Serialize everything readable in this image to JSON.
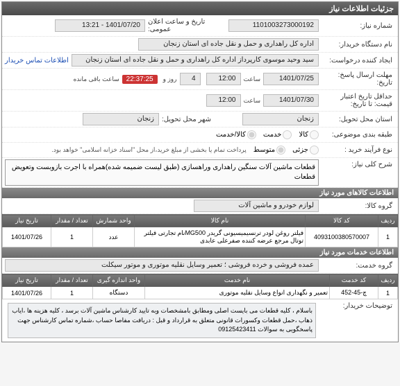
{
  "panel_title": "جزئیات اطلاعات نیاز",
  "rows": {
    "need_no_label": "شماره نیاز:",
    "need_no": "1101003273000192",
    "ann_label": "تاریخ و ساعت اعلان عمومی:",
    "ann_value": "1401/07/20 - 13:21",
    "org_label": "نام دستگاه خریدار:",
    "org_value": "اداره کل راهداری و حمل و نقل جاده ای استان زنجان",
    "creator_label": "ایجاد کننده درخواست:",
    "creator_value": "سید وحید موسوی کارپرداز اداره کل راهداری و حمل و نقل جاده ای استان زنجان",
    "contact_link": "اطلاعات تماس خریدار",
    "deadline_label": "مهلت ارسال پاسخ:",
    "deadline_until_label": "تاریخ:",
    "deadline_date": "1401/07/25",
    "time_label": "ساعت",
    "deadline_time": "12:00",
    "day_label": "روز و",
    "day_value": "4",
    "remain_label": "ساعت باقی مانده",
    "remain_value": "22:37:25",
    "valid_label": "حداقل تاریخ اعتبار",
    "valid_until_label": "قیمت: تا تاریخ:",
    "valid_date": "1401/07/30",
    "valid_time": "12:00",
    "prov_label": "استان محل تحویل:",
    "prov_value": "زنجان",
    "city_label": "شهر محل تحویل:",
    "city_value": "زنجان",
    "cat_label": "طبقه بندی موضوعی:",
    "cat_goods": "کالا",
    "cat_service": "خدمت",
    "cat_both": "کالا/خدمت",
    "proc_label": "نوع فرآیند خرید :",
    "proc_part": "جزئی",
    "proc_med": "متوسط",
    "proc_note": "پرداخت تمام یا بخشی از مبلغ خرید،از محل \"اسناد خزانه اسلامی\" خواهد بود.",
    "title_label": "شرح کلی نیاز:",
    "title_value": "قطعات ماشین آلات سنگین راهداری وراهسازی (طبق لیست ضمیمه شده)همراه با اجرت بازوبست وتعویض قطعات"
  },
  "goods": {
    "header": "اطلاعات کالاهای مورد نیاز",
    "group_label": "گروه کالا:",
    "group_value": "لوازم خودرو و ماشین آلات",
    "cols": {
      "row": "ردیف",
      "code": "کد کالا",
      "name": "نام کالا",
      "unit": "واحد شمارش",
      "qty": "تعداد / مقدار",
      "date": "تاریخ نیاز"
    },
    "items": [
      {
        "row": "1",
        "code": "4093100380570007",
        "name": "فیلتر روغن لودر ترنسیمیسیونی گریدر MG500نام تجارتی فیلتر توتال مرجع عرضه کننده صفرعلی عابدی",
        "unit": "عدد",
        "qty": "1",
        "date": "1401/07/26"
      }
    ]
  },
  "services": {
    "header": "اطلاعات خدمات مورد نیاز",
    "group_label": "گروه خدمت:",
    "group_value": "عمده فروشی و خرده فروشی ؛ تعمیر وسایل نقلیه موتوری و موتور سیکلت",
    "cols": {
      "row": "ردیف",
      "code": "کد خدمت",
      "name": "نام خدمت",
      "unit": "واحد اندازه گیری",
      "qty": "تعداد / مقدار",
      "date": "تاریخ نیاز"
    },
    "items": [
      {
        "row": "1",
        "code": "چ-45-452",
        "name": "تعمیر و نگهداری انواع وسایل نقلیه موتوری",
        "unit": "دستگاه",
        "qty": "1",
        "date": "1401/07/26"
      }
    ]
  },
  "notes": {
    "label": "توضیحات خریدار:",
    "text": "باسلام ، کلیه قطعات می بایست اصلی ومطابق بامشخصات وبه تایید کارشناس ماشین آلات برسد ، کلیه هزینه ها ،ایاب ذهاب ،حمل قطعات وکسورات قانونی متعلق به قرارداد و قبل : دریافت مفاصا حساب ،شماره تماس کارشناس جهت پاسخگویی به سوالات 09125423411"
  }
}
